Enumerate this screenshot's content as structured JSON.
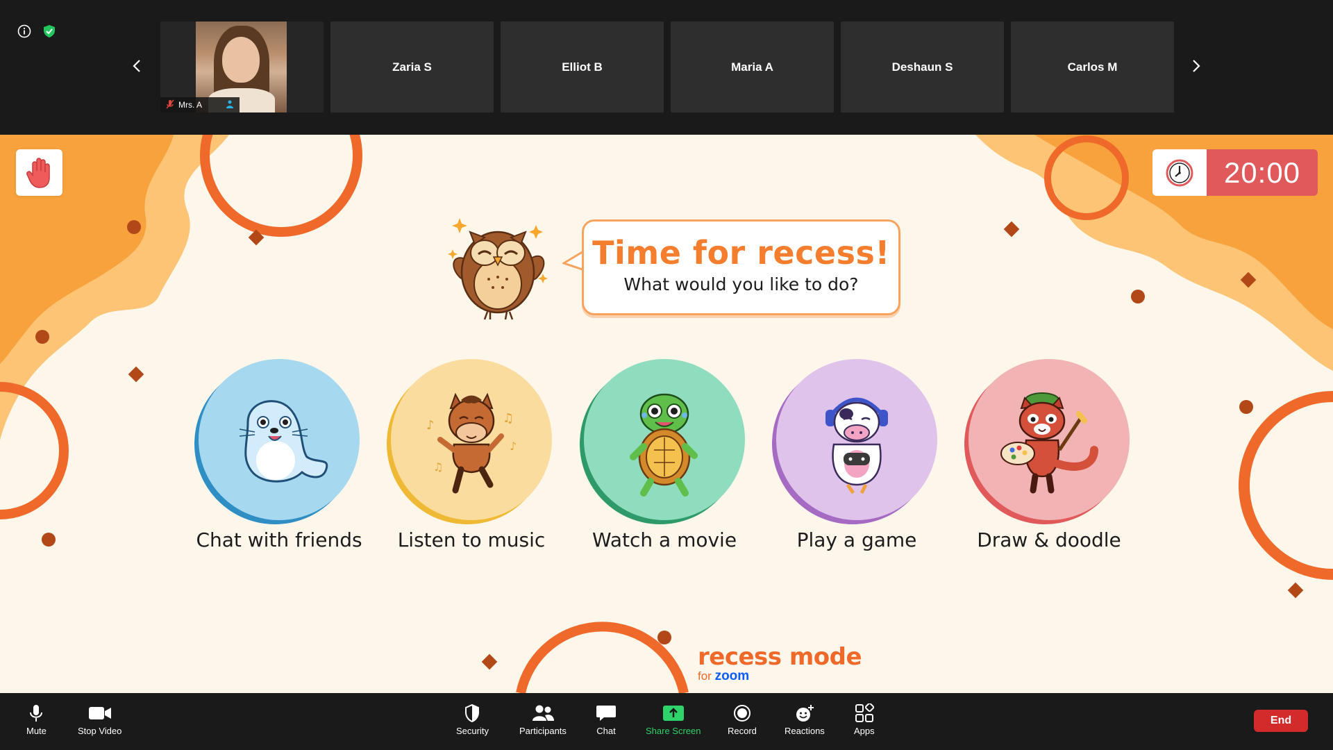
{
  "participants": {
    "self_name": "Mrs. A",
    "tiles": [
      "Zaria S",
      "Elliot B",
      "Maria A",
      "Deshaun S",
      "Carlos M"
    ]
  },
  "timer": {
    "value": "20:00"
  },
  "prompt": {
    "title": "Time for recess!",
    "subtitle": "What would you like to do?"
  },
  "activities": [
    {
      "label": "Chat with friends",
      "animal": "seal",
      "color": "#a6d8ef",
      "ring": "#2f8fc4"
    },
    {
      "label": "Listen to music",
      "animal": "horse",
      "color": "#fbdc9f",
      "ring": "#f0b935"
    },
    {
      "label": "Watch a movie",
      "animal": "turtle",
      "color": "#8fdcbf",
      "ring": "#2e9a69"
    },
    {
      "label": "Play a game",
      "animal": "cow",
      "color": "#dfc3eb",
      "ring": "#a56bc2"
    },
    {
      "label": "Draw & doodle",
      "animal": "red-panda",
      "color": "#f2b3b4",
      "ring": "#e05a5c"
    }
  ],
  "brand": {
    "name": "recess mode",
    "for": "for",
    "zoom": "zoom"
  },
  "toolbar": {
    "mute": "Mute",
    "stop_video": "Stop Video",
    "security": "Security",
    "participants": "Participants",
    "chat": "Chat",
    "share_screen": "Share Screen",
    "record": "Record",
    "reactions": "Reactions",
    "apps": "Apps",
    "end": "End"
  },
  "colors": {
    "accent_orange": "#f47e2e",
    "timer_red": "#e05a5c",
    "share_green": "#2fd36b",
    "end_red": "#d32b2b"
  }
}
